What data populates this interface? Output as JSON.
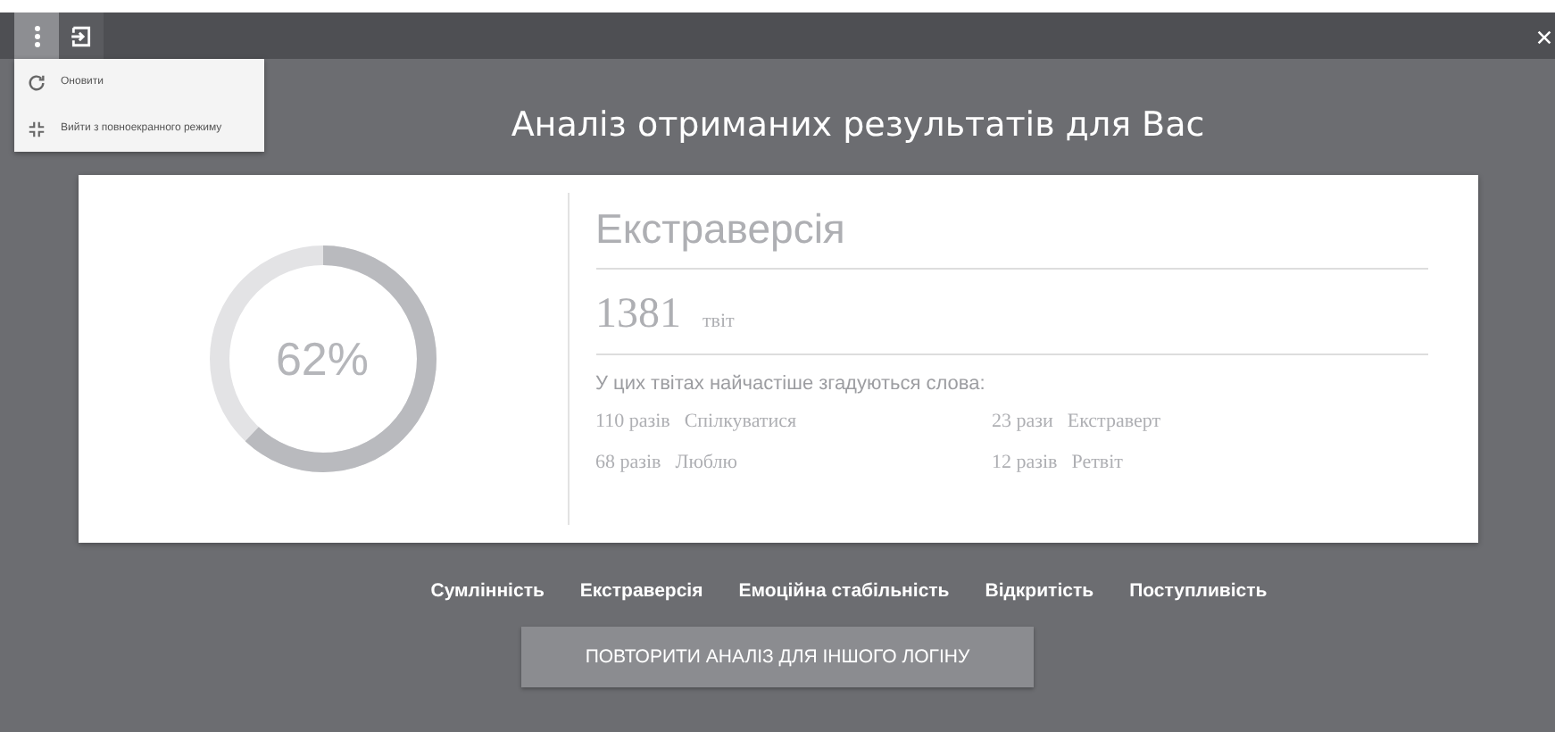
{
  "menu": {
    "items": [
      {
        "kind": "refresh",
        "label": "Оновити"
      },
      {
        "kind": "exit-fullscreen",
        "label": "Вийти з повноекранного режиму"
      }
    ]
  },
  "title": "Аналіз отриманих результатів для Вас",
  "result": {
    "percent": "62%",
    "level": 0.62,
    "trait": "Екстраверсія",
    "count": "1381",
    "count_unit": "твіт",
    "words_heading": "У цих твітах найчастіше згадуються слова:",
    "words": [
      {
        "times": "110 разів",
        "word": "Спілкуватися"
      },
      {
        "times": "23 рази",
        "word": "Екстраверт"
      },
      {
        "times": "68 разів",
        "word": "Люблю"
      },
      {
        "times": "12 разів",
        "word": "Ретвіт"
      }
    ]
  },
  "traits": [
    "Сумлінність",
    "Екстраверсія",
    "Емоційна стабільність",
    "Відкритість",
    "Поступливість"
  ],
  "repeat_button": "ПОВТОРИТИ АНАЛІЗ ДЛЯ ІНШОГО ЛОГІНУ"
}
